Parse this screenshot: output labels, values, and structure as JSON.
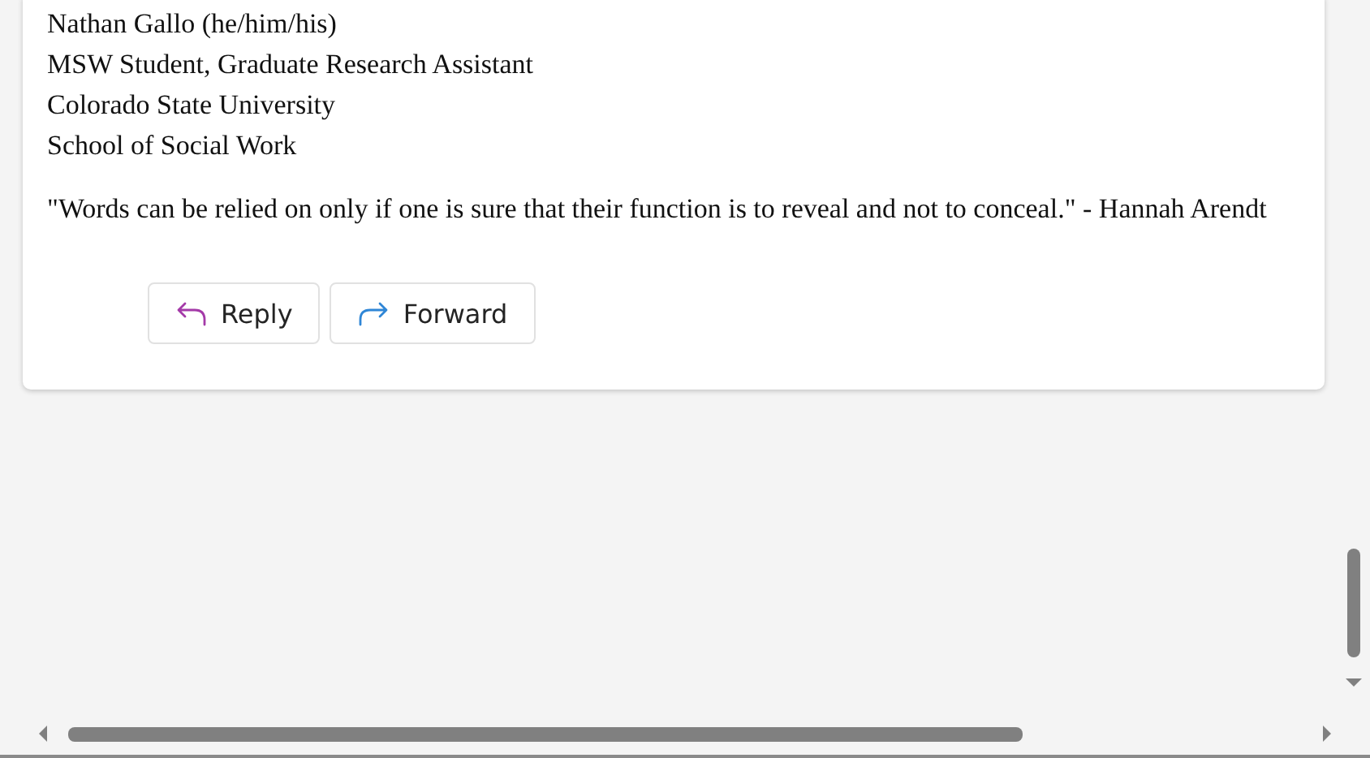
{
  "message": {
    "signature": [
      "Nathan Gallo (he/him/his)",
      "MSW Student, Graduate Research Assistant",
      "Colorado State University",
      "School of Social Work"
    ],
    "quote": "\"Words can be relied on only if one is sure that their function is to reveal and not to conceal.\" - Hannah Arendt"
  },
  "actions": [
    {
      "kind": "reply",
      "label": "Reply"
    },
    {
      "kind": "forward",
      "label": "Forward"
    }
  ]
}
